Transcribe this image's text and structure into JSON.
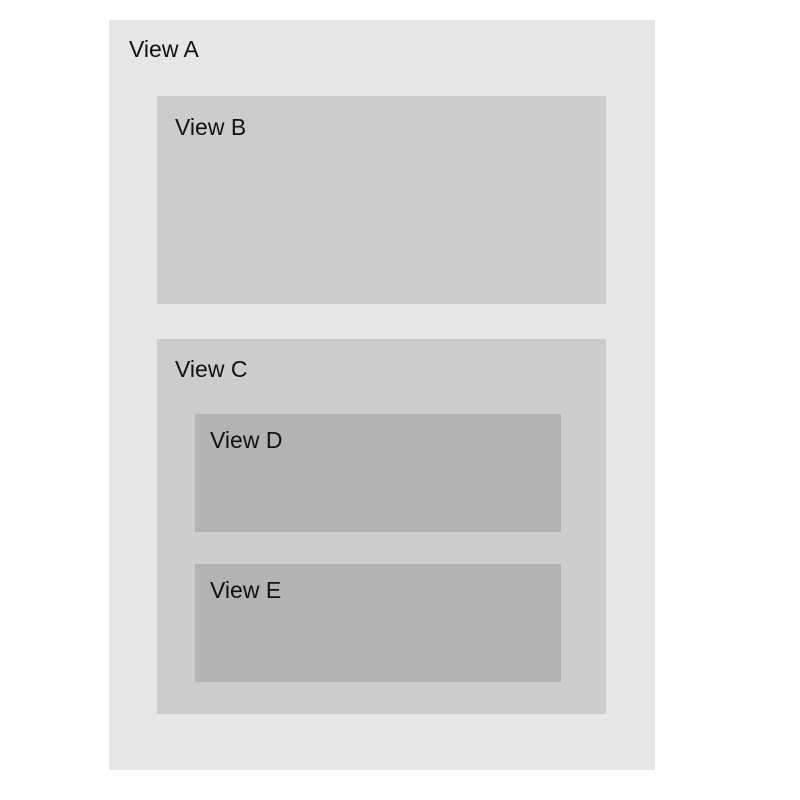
{
  "views": {
    "a": {
      "label": "View A",
      "color": "#e6e6e6"
    },
    "b": {
      "label": "View B",
      "color": "#cccccc"
    },
    "c": {
      "label": "View C",
      "color": "#cccccc"
    },
    "d": {
      "label": "View D",
      "color": "#b3b3b3"
    },
    "e": {
      "label": "View E",
      "color": "#b3b3b3"
    }
  }
}
